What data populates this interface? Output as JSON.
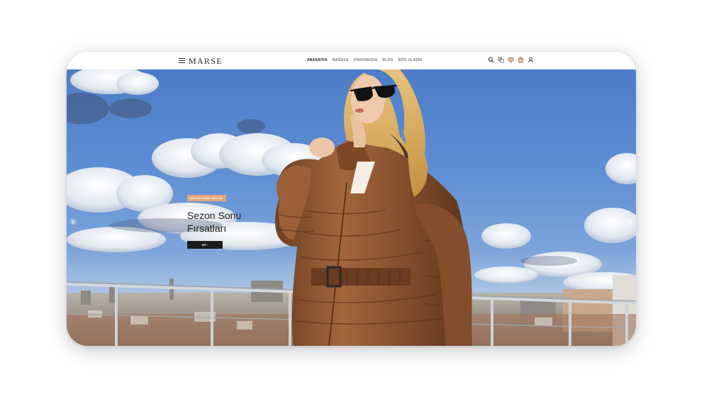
{
  "header": {
    "brand": "MARSE",
    "nav": [
      "ANASAYFA",
      "MAĞAZA",
      "HAKKIMIZDA",
      "BLOG",
      "BİZE ULAŞIN"
    ],
    "icons": [
      "search-icon",
      "compare-icon",
      "wishlist-icon",
      "cart-icon",
      "user-icon"
    ]
  },
  "hero": {
    "badge": "SEZON SONU BÜYÜK",
    "title": "Sezon Sonu Fırsatları",
    "button": "GİT ›"
  },
  "colors": {
    "accent": "#e3a77b",
    "button_bg": "#1b1b1b",
    "jacket": "#8a5330"
  }
}
